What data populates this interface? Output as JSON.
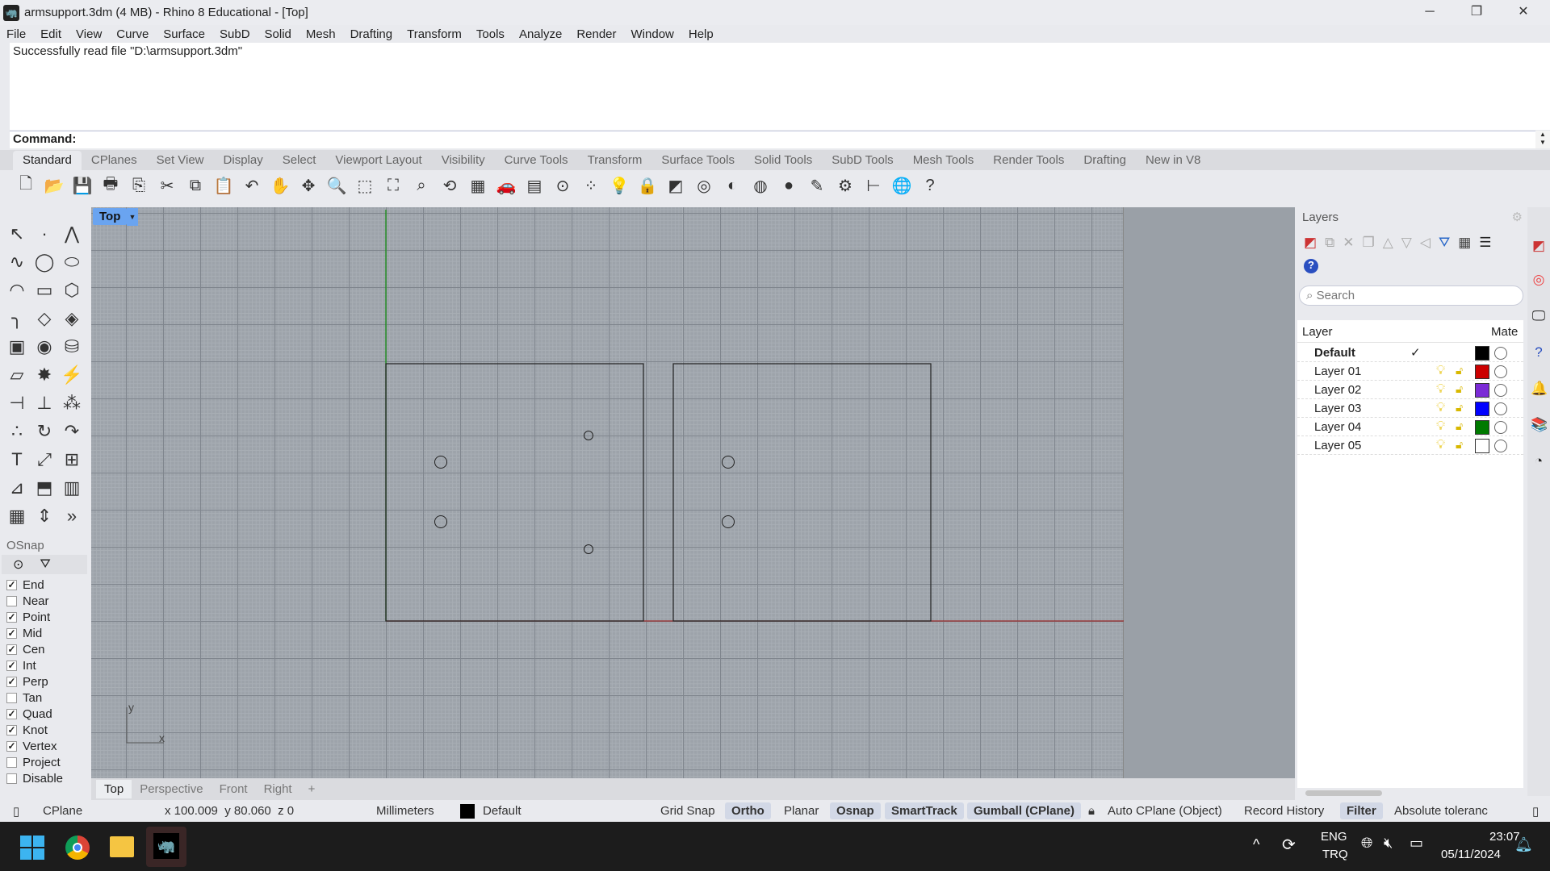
{
  "window": {
    "title": "armsupport.3dm (4 MB) - Rhino 8 Educational - [Top]",
    "minimize": "─",
    "restore": "❐",
    "close": "✕"
  },
  "menu": [
    "File",
    "Edit",
    "View",
    "Curve",
    "Surface",
    "SubD",
    "Solid",
    "Mesh",
    "Drafting",
    "Transform",
    "Tools",
    "Analyze",
    "Render",
    "Window",
    "Help"
  ],
  "command": {
    "history": "Successfully read file \"D:\\armsupport.3dm\"",
    "prompt": "Command:"
  },
  "toolbar_tabs": [
    "Standard",
    "CPlanes",
    "Set View",
    "Display",
    "Select",
    "Viewport Layout",
    "Visibility",
    "Curve Tools",
    "Transform",
    "Surface Tools",
    "Solid Tools",
    "SubD Tools",
    "Mesh Tools",
    "Render Tools",
    "Drafting",
    "New in V8"
  ],
  "active_tab": "Standard",
  "toolbar_icons": [
    [
      "new-icon",
      "🗋"
    ],
    [
      "open-icon",
      "📂"
    ],
    [
      "save-icon",
      "💾"
    ],
    [
      "print-icon",
      "🖶"
    ],
    [
      "export-icon",
      "⎘"
    ],
    [
      "cut-icon",
      "✂"
    ],
    [
      "copy-icon",
      "⧉"
    ],
    [
      "paste-icon",
      "📋"
    ],
    [
      "undo-icon",
      "↶"
    ],
    [
      "pan-icon",
      "✋"
    ],
    [
      "rotate-view-icon",
      "✥"
    ],
    [
      "zoom-icon",
      "🔍"
    ],
    [
      "zoom-window-icon",
      "⬚"
    ],
    [
      "zoom-extents-icon",
      "⛶"
    ],
    [
      "zoom-selected-icon",
      "⌕"
    ],
    [
      "undo-view-icon",
      "⟲"
    ],
    [
      "four-viewports-icon",
      "▦"
    ],
    [
      "car-icon",
      "🚗"
    ],
    [
      "grid-icon",
      "▤"
    ],
    [
      "cplane-icon",
      "⊙"
    ],
    [
      "points-icon",
      "⁘"
    ],
    [
      "light-icon",
      "💡"
    ],
    [
      "lock-icon",
      "🔒"
    ],
    [
      "layer-icon",
      "◩"
    ],
    [
      "color-wheel-icon",
      "◎"
    ],
    [
      "wireframe-sphere-icon",
      "◐"
    ],
    [
      "rendered-sphere-icon",
      "◍"
    ],
    [
      "render-icon",
      "●"
    ],
    [
      "ortho-pencil-icon",
      "✎"
    ],
    [
      "settings-gear-icon",
      "⚙"
    ],
    [
      "dimension-icon",
      "⊢"
    ],
    [
      "globe-icon",
      "🌐"
    ],
    [
      "help-icon",
      "?"
    ]
  ],
  "toolbox_icons": [
    [
      "select-arrow-icon",
      "↖"
    ],
    [
      "point-icon",
      "·"
    ],
    [
      "polyline-icon",
      "⋀"
    ],
    [
      "curve-icon",
      "∿"
    ],
    [
      "circle-icon",
      "◯"
    ],
    [
      "ellipse-icon",
      "⬭"
    ],
    [
      "arc-icon",
      "◠"
    ],
    [
      "rectangle-icon",
      "▭"
    ],
    [
      "polygon-icon",
      "⬡"
    ],
    [
      "fillet-icon",
      "╮"
    ],
    [
      "surface-corner-icon",
      "◇"
    ],
    [
      "loft-icon",
      "◈"
    ],
    [
      "box-icon",
      "▣"
    ],
    [
      "boolean-icon",
      "◉"
    ],
    [
      "cylinder-icon",
      "⛁"
    ],
    [
      "mesh-plane-icon",
      "▱"
    ],
    [
      "explode-icon",
      "✸"
    ],
    [
      "trim-icon",
      "⚡"
    ],
    [
      "split-icon",
      "⊣"
    ],
    [
      "extrude-icon",
      "⊥"
    ],
    [
      "group-icon",
      "⁂"
    ],
    [
      "control-points-icon",
      "∴"
    ],
    [
      "rotate-icon",
      "↻"
    ],
    [
      "blend-icon",
      "↷"
    ],
    [
      "text-icon",
      "T"
    ],
    [
      "scale-icon",
      "⤢"
    ],
    [
      "array-icon",
      "⊞"
    ],
    [
      "dimension-icon",
      "⊿"
    ],
    [
      "solid-edit-icon",
      "⬒"
    ],
    [
      "hatch-icon",
      "▥"
    ],
    [
      "array-grid-icon",
      "▦"
    ],
    [
      "gumball-icon",
      "⇕"
    ],
    [
      "more-icon",
      "»"
    ]
  ],
  "osnap": {
    "title": "OSnap",
    "items": [
      {
        "label": "End",
        "checked": true
      },
      {
        "label": "Near",
        "checked": false
      },
      {
        "label": "Point",
        "checked": true
      },
      {
        "label": "Mid",
        "checked": true
      },
      {
        "label": "Cen",
        "checked": true
      },
      {
        "label": "Int",
        "checked": true
      },
      {
        "label": "Perp",
        "checked": true
      },
      {
        "label": "Tan",
        "checked": false
      },
      {
        "label": "Quad",
        "checked": true
      },
      {
        "label": "Knot",
        "checked": true
      },
      {
        "label": "Vertex",
        "checked": true
      },
      {
        "label": "Project",
        "checked": false
      },
      {
        "label": "Disable",
        "checked": false
      }
    ]
  },
  "viewport": {
    "name": "Top",
    "axis_x": "x",
    "axis_y": "y"
  },
  "viewport_tabs": [
    "Top",
    "Perspective",
    "Front",
    "Right"
  ],
  "layers": {
    "title": "Layers",
    "search_placeholder": "Search",
    "col_layer": "Layer",
    "col_material": "Mate",
    "rows": [
      {
        "name": "Default",
        "current": true,
        "color": "#000000"
      },
      {
        "name": "Layer 01",
        "color": "#cc0000"
      },
      {
        "name": "Layer 02",
        "color": "#7b2bd6"
      },
      {
        "name": "Layer 03",
        "color": "#0000ff"
      },
      {
        "name": "Layer 04",
        "color": "#007a00"
      },
      {
        "name": "Layer 05",
        "color": "#ffffff"
      }
    ]
  },
  "status": {
    "cplane": "CPlane",
    "coords": "x 100.009  y 80.060  z 0",
    "units": "Millimeters",
    "layer": "Default",
    "grid_snap": "Grid Snap",
    "ortho": "Ortho",
    "planar": "Planar",
    "osnap": "Osnap",
    "smarttrack": "SmartTrack",
    "gumball": "Gumball (CPlane)",
    "auto_cplane": "Auto CPlane (Object)",
    "record_history": "Record History",
    "filter": "Filter",
    "tolerance": "Absolute toleranc"
  },
  "taskbar": {
    "lang": "ENG",
    "lang2": "TRQ",
    "time": "23:07",
    "date": "05/11/2024"
  }
}
